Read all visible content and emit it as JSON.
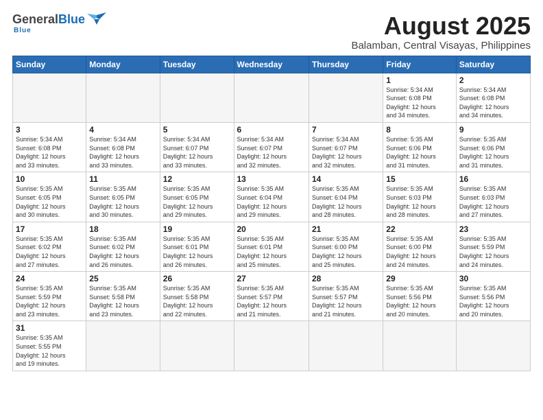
{
  "header": {
    "logo_general": "General",
    "logo_blue": "Blue",
    "logo_underline": "Blue",
    "title": "August 2025",
    "subtitle": "Balamban, Central Visayas, Philippines"
  },
  "days_of_week": [
    "Sunday",
    "Monday",
    "Tuesday",
    "Wednesday",
    "Thursday",
    "Friday",
    "Saturday"
  ],
  "weeks": [
    [
      {
        "day": "",
        "info": "",
        "empty": true
      },
      {
        "day": "",
        "info": "",
        "empty": true
      },
      {
        "day": "",
        "info": "",
        "empty": true
      },
      {
        "day": "",
        "info": "",
        "empty": true
      },
      {
        "day": "",
        "info": "",
        "empty": true
      },
      {
        "day": "1",
        "info": "Sunrise: 5:34 AM\nSunset: 6:08 PM\nDaylight: 12 hours\nand 34 minutes."
      },
      {
        "day": "2",
        "info": "Sunrise: 5:34 AM\nSunset: 6:08 PM\nDaylight: 12 hours\nand 34 minutes."
      }
    ],
    [
      {
        "day": "3",
        "info": "Sunrise: 5:34 AM\nSunset: 6:08 PM\nDaylight: 12 hours\nand 33 minutes."
      },
      {
        "day": "4",
        "info": "Sunrise: 5:34 AM\nSunset: 6:08 PM\nDaylight: 12 hours\nand 33 minutes."
      },
      {
        "day": "5",
        "info": "Sunrise: 5:34 AM\nSunset: 6:07 PM\nDaylight: 12 hours\nand 33 minutes."
      },
      {
        "day": "6",
        "info": "Sunrise: 5:34 AM\nSunset: 6:07 PM\nDaylight: 12 hours\nand 32 minutes."
      },
      {
        "day": "7",
        "info": "Sunrise: 5:34 AM\nSunset: 6:07 PM\nDaylight: 12 hours\nand 32 minutes."
      },
      {
        "day": "8",
        "info": "Sunrise: 5:35 AM\nSunset: 6:06 PM\nDaylight: 12 hours\nand 31 minutes."
      },
      {
        "day": "9",
        "info": "Sunrise: 5:35 AM\nSunset: 6:06 PM\nDaylight: 12 hours\nand 31 minutes."
      }
    ],
    [
      {
        "day": "10",
        "info": "Sunrise: 5:35 AM\nSunset: 6:05 PM\nDaylight: 12 hours\nand 30 minutes."
      },
      {
        "day": "11",
        "info": "Sunrise: 5:35 AM\nSunset: 6:05 PM\nDaylight: 12 hours\nand 30 minutes."
      },
      {
        "day": "12",
        "info": "Sunrise: 5:35 AM\nSunset: 6:05 PM\nDaylight: 12 hours\nand 29 minutes."
      },
      {
        "day": "13",
        "info": "Sunrise: 5:35 AM\nSunset: 6:04 PM\nDaylight: 12 hours\nand 29 minutes."
      },
      {
        "day": "14",
        "info": "Sunrise: 5:35 AM\nSunset: 6:04 PM\nDaylight: 12 hours\nand 28 minutes."
      },
      {
        "day": "15",
        "info": "Sunrise: 5:35 AM\nSunset: 6:03 PM\nDaylight: 12 hours\nand 28 minutes."
      },
      {
        "day": "16",
        "info": "Sunrise: 5:35 AM\nSunset: 6:03 PM\nDaylight: 12 hours\nand 27 minutes."
      }
    ],
    [
      {
        "day": "17",
        "info": "Sunrise: 5:35 AM\nSunset: 6:02 PM\nDaylight: 12 hours\nand 27 minutes."
      },
      {
        "day": "18",
        "info": "Sunrise: 5:35 AM\nSunset: 6:02 PM\nDaylight: 12 hours\nand 26 minutes."
      },
      {
        "day": "19",
        "info": "Sunrise: 5:35 AM\nSunset: 6:01 PM\nDaylight: 12 hours\nand 26 minutes."
      },
      {
        "day": "20",
        "info": "Sunrise: 5:35 AM\nSunset: 6:01 PM\nDaylight: 12 hours\nand 25 minutes."
      },
      {
        "day": "21",
        "info": "Sunrise: 5:35 AM\nSunset: 6:00 PM\nDaylight: 12 hours\nand 25 minutes."
      },
      {
        "day": "22",
        "info": "Sunrise: 5:35 AM\nSunset: 6:00 PM\nDaylight: 12 hours\nand 24 minutes."
      },
      {
        "day": "23",
        "info": "Sunrise: 5:35 AM\nSunset: 5:59 PM\nDaylight: 12 hours\nand 24 minutes."
      }
    ],
    [
      {
        "day": "24",
        "info": "Sunrise: 5:35 AM\nSunset: 5:59 PM\nDaylight: 12 hours\nand 23 minutes."
      },
      {
        "day": "25",
        "info": "Sunrise: 5:35 AM\nSunset: 5:58 PM\nDaylight: 12 hours\nand 23 minutes."
      },
      {
        "day": "26",
        "info": "Sunrise: 5:35 AM\nSunset: 5:58 PM\nDaylight: 12 hours\nand 22 minutes."
      },
      {
        "day": "27",
        "info": "Sunrise: 5:35 AM\nSunset: 5:57 PM\nDaylight: 12 hours\nand 21 minutes."
      },
      {
        "day": "28",
        "info": "Sunrise: 5:35 AM\nSunset: 5:57 PM\nDaylight: 12 hours\nand 21 minutes."
      },
      {
        "day": "29",
        "info": "Sunrise: 5:35 AM\nSunset: 5:56 PM\nDaylight: 12 hours\nand 20 minutes."
      },
      {
        "day": "30",
        "info": "Sunrise: 5:35 AM\nSunset: 5:56 PM\nDaylight: 12 hours\nand 20 minutes."
      }
    ],
    [
      {
        "day": "31",
        "info": "Sunrise: 5:35 AM\nSunset: 5:55 PM\nDaylight: 12 hours\nand 19 minutes.",
        "last": true
      },
      {
        "day": "",
        "info": "",
        "empty": true,
        "last": true
      },
      {
        "day": "",
        "info": "",
        "empty": true,
        "last": true
      },
      {
        "day": "",
        "info": "",
        "empty": true,
        "last": true
      },
      {
        "day": "",
        "info": "",
        "empty": true,
        "last": true
      },
      {
        "day": "",
        "info": "",
        "empty": true,
        "last": true
      },
      {
        "day": "",
        "info": "",
        "empty": true,
        "last": true
      }
    ]
  ]
}
